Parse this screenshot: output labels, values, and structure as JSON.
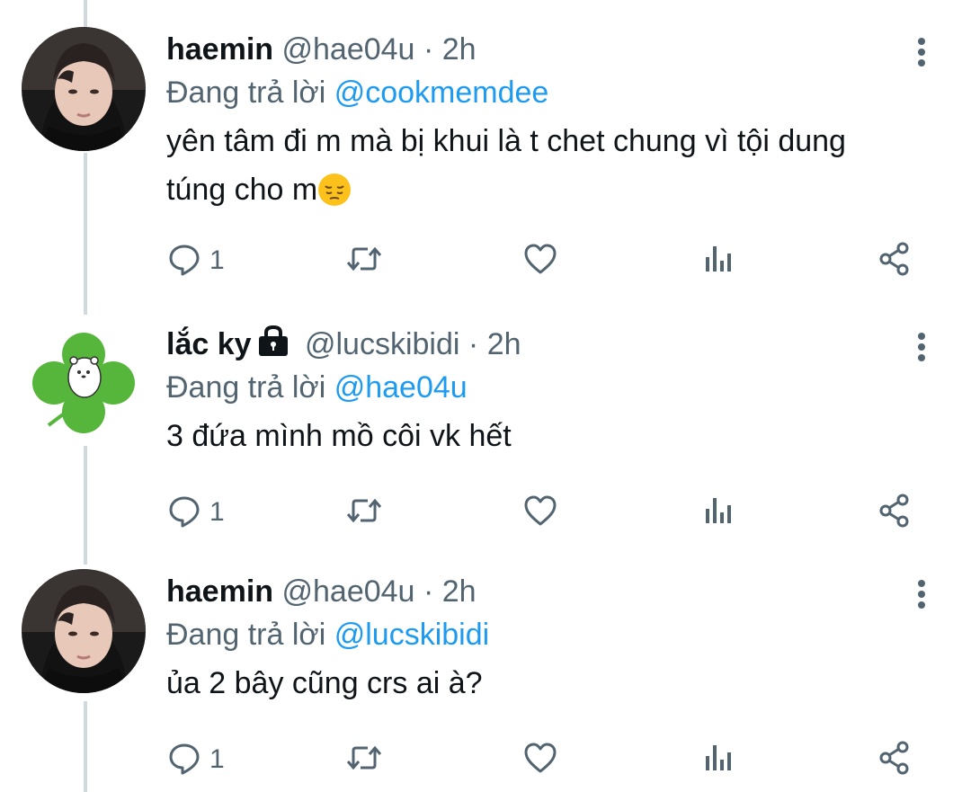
{
  "colors": {
    "text": "#0f1419",
    "secondary": "#536471",
    "accent": "#1d9bf0",
    "thread_line": "#cfd9de"
  },
  "tweets": [
    {
      "name": "haemin",
      "handle": "@hae04u",
      "separator": "·",
      "time": "2h",
      "replying_label": "Đang trả lời",
      "replying_to": "@cookmemdee",
      "text": "yên tâm đi m mà bị khui là t chet chung vì tội dung túng cho m",
      "emoji": "pensive-face-emoji",
      "protected": false,
      "reply_count": "1",
      "avatar": "portrait-photo"
    },
    {
      "name": "lắc ky",
      "handle": "@lucskibidi",
      "separator": "·",
      "time": "2h",
      "replying_label": "Đang trả lời",
      "replying_to": "@hae04u",
      "text": "3 đứa mình mồ côi vk hết",
      "protected": true,
      "reply_count": "1",
      "avatar": "clover-with-bear"
    },
    {
      "name": "haemin",
      "handle": "@hae04u",
      "separator": "·",
      "time": "2h",
      "replying_label": "Đang trả lời",
      "replying_to": "@lucskibidi",
      "text": "ủa 2 bây cũng crs ai à?",
      "protected": false,
      "reply_count": "1",
      "avatar": "portrait-photo"
    }
  ],
  "icons": [
    "reply-icon",
    "retweet-icon",
    "like-icon",
    "analytics-icon",
    "share-icon",
    "more-options-icon",
    "lock-icon"
  ]
}
